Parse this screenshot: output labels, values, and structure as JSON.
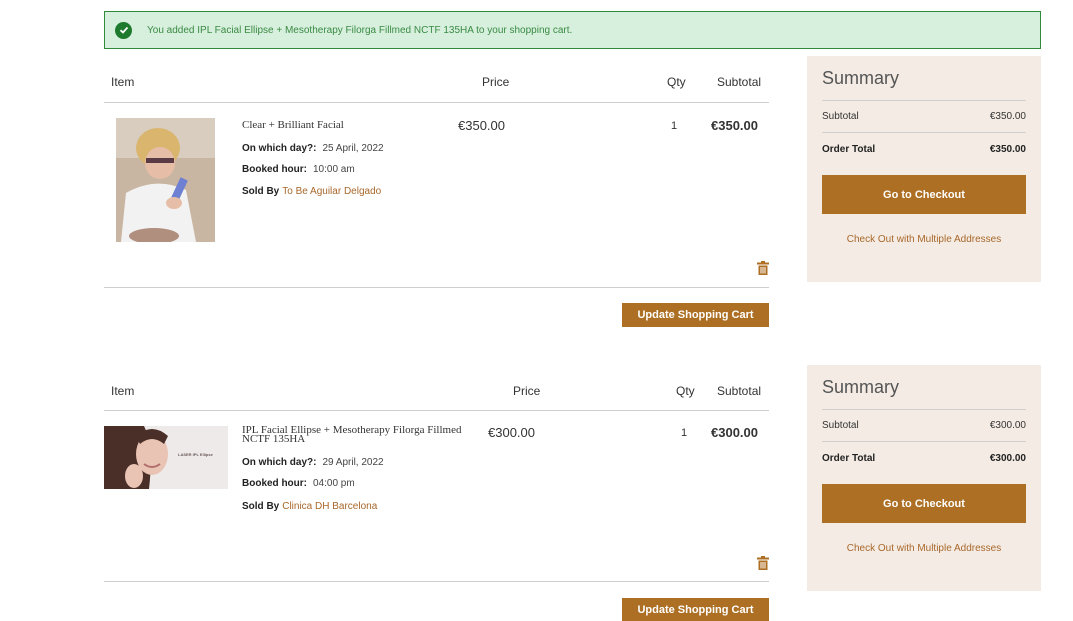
{
  "message": {
    "text": "You added IPL Facial Ellipse + Mesotherapy Filorga Fillmed NCTF 135HA to your shopping cart.",
    "icon": "check-circle-icon"
  },
  "carts": [
    {
      "headers": {
        "item": "Item",
        "price": "Price",
        "qty": "Qty",
        "subtotal": "Subtotal"
      },
      "item": {
        "name": "Clear + Brilliant Facial",
        "day_label": "On which day?:",
        "day_value": "25 April, 2022",
        "hour_label": "Booked hour:",
        "hour_value": "10:00 am",
        "sold_label": "Sold By",
        "seller": "To Be Aguilar Delgado",
        "price": "€350.00",
        "qty": "1",
        "subtotal": "€350.00"
      },
      "update_label": "Update Shopping Cart",
      "summary": {
        "title": "Summary",
        "subtotal_label": "Subtotal",
        "subtotal_value": "€350.00",
        "total_label": "Order Total",
        "total_value": "€350.00",
        "checkout_label": "Go to Checkout",
        "multi_label": "Check Out with Multiple Addresses"
      }
    },
    {
      "headers": {
        "item": "Item",
        "price": "Price",
        "qty": "Qty",
        "subtotal": "Subtotal"
      },
      "item": {
        "name": "IPL Facial Ellipse + Mesotherapy Filorga Fillmed NCTF 135HA",
        "day_label": "On which day?:",
        "day_value": "29 April, 2022",
        "hour_label": "Booked hour:",
        "hour_value": "04:00 pm",
        "sold_label": "Sold By",
        "seller": "Clinica DH Barcelona",
        "price": "€300.00",
        "qty": "1",
        "subtotal": "€300.00",
        "image_caption": "LASER IPL Ellipse"
      },
      "update_label": "Update Shopping Cart",
      "summary": {
        "title": "Summary",
        "subtotal_label": "Subtotal",
        "subtotal_value": "€300.00",
        "total_label": "Order Total",
        "total_value": "€300.00",
        "checkout_label": "Go to Checkout",
        "multi_label": "Check Out with Multiple Addresses"
      }
    }
  ],
  "colors": {
    "accent": "#ad6f23",
    "success_bg": "#d7f0dd",
    "summary_bg": "#f4ece4"
  }
}
